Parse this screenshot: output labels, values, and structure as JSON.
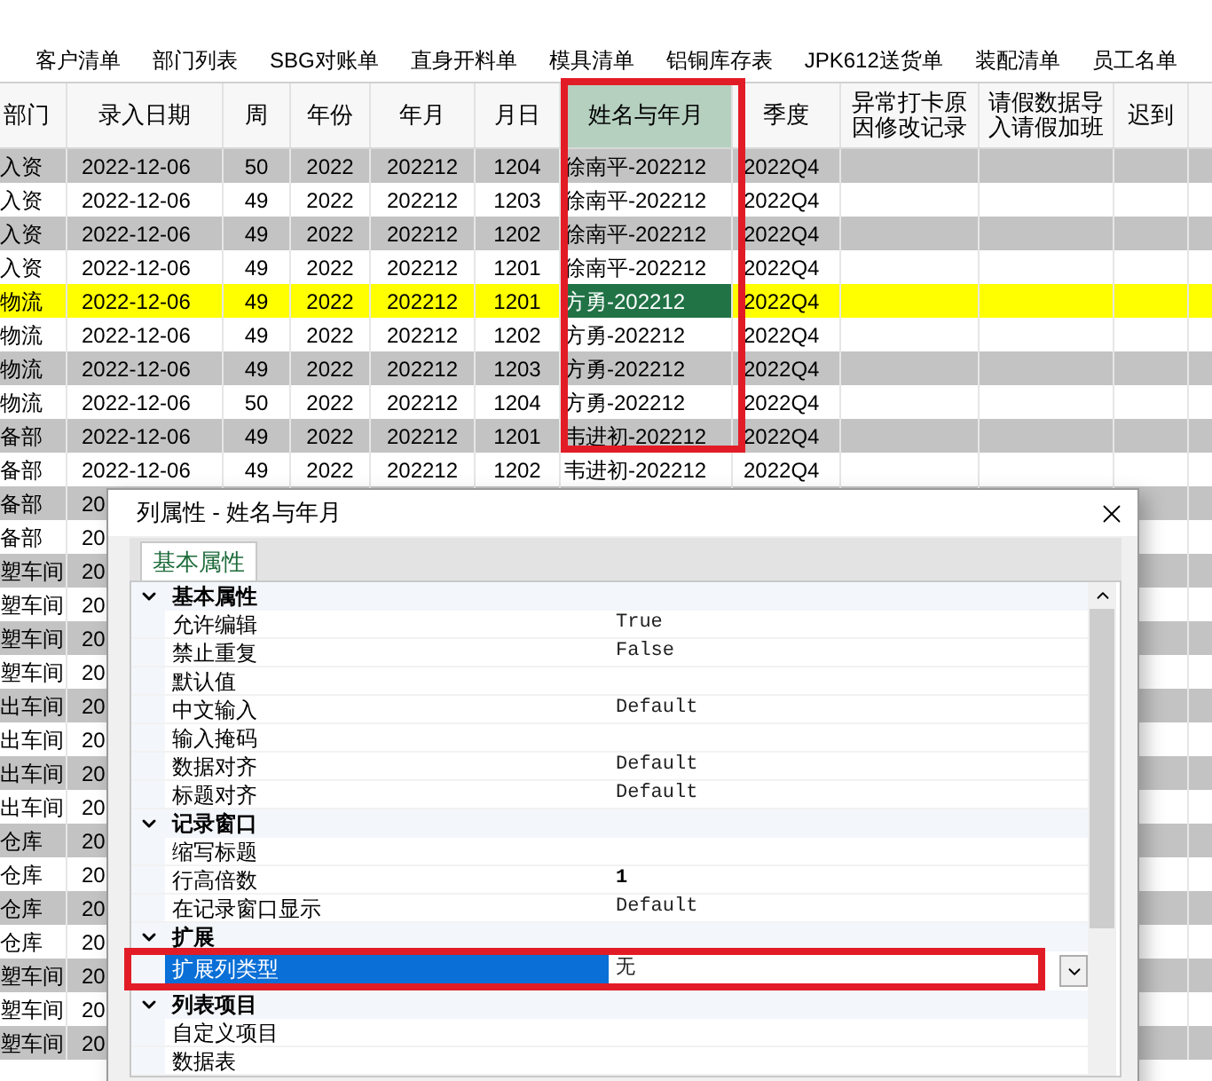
{
  "tabs": [
    {
      "label": "客户清单"
    },
    {
      "label": "部门列表"
    },
    {
      "label": "SBG对账单"
    },
    {
      "label": "直身开料单"
    },
    {
      "label": "模具清单"
    },
    {
      "label": "铝铜库存表"
    },
    {
      "label": "JPK612送货单"
    },
    {
      "label": "装配清单"
    },
    {
      "label": "员工名单"
    }
  ],
  "table": {
    "columns": [
      {
        "label": "部门",
        "selected": false
      },
      {
        "label": "录入日期",
        "selected": false
      },
      {
        "label": "周",
        "selected": false
      },
      {
        "label": "年份",
        "selected": false
      },
      {
        "label": "年月",
        "selected": false
      },
      {
        "label": "月日",
        "selected": false
      },
      {
        "label": "姓名与年月",
        "selected": true
      },
      {
        "label": "季度",
        "selected": false
      },
      {
        "label": "异常打卡原因修改记录",
        "selected": false
      },
      {
        "label": "请假数据导入请假加班",
        "selected": false
      },
      {
        "label": "迟到",
        "selected": false
      }
    ],
    "rows": [
      {
        "selected": false,
        "cells": [
          "入资",
          "2022-12-06",
          "50",
          "2022",
          "202212",
          "1204",
          "徐南平-202212",
          "2022Q4"
        ]
      },
      {
        "selected": false,
        "cells": [
          "入资",
          "2022-12-06",
          "49",
          "2022",
          "202212",
          "1203",
          "徐南平-202212",
          "2022Q4"
        ]
      },
      {
        "selected": false,
        "cells": [
          "入资",
          "2022-12-06",
          "49",
          "2022",
          "202212",
          "1202",
          "徐南平-202212",
          "2022Q4"
        ]
      },
      {
        "selected": false,
        "cells": [
          "入资",
          "2022-12-06",
          "49",
          "2022",
          "202212",
          "1201",
          "徐南平-202212",
          "2022Q4"
        ]
      },
      {
        "selected": true,
        "cells": [
          "物流",
          "2022-12-06",
          "49",
          "2022",
          "202212",
          "1201",
          "方勇-202212",
          "2022Q4"
        ]
      },
      {
        "selected": false,
        "cells": [
          "物流",
          "2022-12-06",
          "49",
          "2022",
          "202212",
          "1202",
          "方勇-202212",
          "2022Q4"
        ]
      },
      {
        "selected": false,
        "cells": [
          "物流",
          "2022-12-06",
          "49",
          "2022",
          "202212",
          "1203",
          "方勇-202212",
          "2022Q4"
        ]
      },
      {
        "selected": false,
        "cells": [
          "物流",
          "2022-12-06",
          "50",
          "2022",
          "202212",
          "1204",
          "方勇-202212",
          "2022Q4"
        ]
      },
      {
        "selected": false,
        "cells": [
          "备部",
          "2022-12-06",
          "49",
          "2022",
          "202212",
          "1201",
          "韦进初-202212",
          "2022Q4"
        ]
      },
      {
        "selected": false,
        "cells": [
          "备部",
          "2022-12-06",
          "49",
          "2022",
          "202212",
          "1202",
          "韦进初-202212",
          "2022Q4"
        ]
      },
      {
        "selected": false,
        "cells": [
          "备部",
          "20"
        ]
      },
      {
        "selected": false,
        "cells": [
          "备部",
          "20"
        ]
      },
      {
        "selected": false,
        "cells": [
          "塑车间",
          "20"
        ]
      },
      {
        "selected": false,
        "cells": [
          "塑车间",
          "20"
        ]
      },
      {
        "selected": false,
        "cells": [
          "塑车间",
          "20"
        ]
      },
      {
        "selected": false,
        "cells": [
          "塑车间",
          "20"
        ]
      },
      {
        "selected": false,
        "cells": [
          "出车间",
          "20"
        ]
      },
      {
        "selected": false,
        "cells": [
          "出车间",
          "20"
        ]
      },
      {
        "selected": false,
        "cells": [
          "出车间",
          "20"
        ]
      },
      {
        "selected": false,
        "cells": [
          "出车间",
          "20"
        ]
      },
      {
        "selected": false,
        "cells": [
          "仓库",
          "20"
        ]
      },
      {
        "selected": false,
        "cells": [
          "仓库",
          "20"
        ]
      },
      {
        "selected": false,
        "cells": [
          "仓库",
          "20"
        ]
      },
      {
        "selected": false,
        "cells": [
          "仓库",
          "20"
        ]
      },
      {
        "selected": false,
        "cells": [
          "塑车间",
          "20"
        ]
      },
      {
        "selected": false,
        "cells": [
          "塑车间",
          "20"
        ]
      },
      {
        "selected": false,
        "cells": [
          "塑车间",
          "20"
        ]
      }
    ]
  },
  "dialog": {
    "title": "列属性 - 姓名与年月",
    "tabs": [
      {
        "label": "基本属性",
        "selected": true
      }
    ],
    "properties": [
      {
        "kind": "category",
        "label": "基本属性",
        "expanded": true
      },
      {
        "kind": "property",
        "name": "允许编辑",
        "value": "True",
        "modified": false,
        "selected": false
      },
      {
        "kind": "property",
        "name": "禁止重复",
        "value": "False",
        "modified": false,
        "selected": false
      },
      {
        "kind": "property",
        "name": "默认值",
        "selected": false
      },
      {
        "kind": "property",
        "name": "中文输入",
        "value": "Default",
        "modified": false,
        "selected": false
      },
      {
        "kind": "property",
        "name": "输入掩码",
        "selected": false
      },
      {
        "kind": "property",
        "name": "数据对齐",
        "value": "Default",
        "modified": false,
        "selected": false
      },
      {
        "kind": "property",
        "name": "标题对齐",
        "value": "Default",
        "modified": false,
        "selected": false
      },
      {
        "kind": "category",
        "label": "记录窗口",
        "expanded": true
      },
      {
        "kind": "property",
        "name": "缩写标题",
        "selected": false
      },
      {
        "kind": "property",
        "name": "行高倍数",
        "value": "1",
        "modified": true,
        "selected": false
      },
      {
        "kind": "property",
        "name": "在记录窗口显示",
        "value": "Default",
        "modified": false,
        "selected": false
      },
      {
        "kind": "category",
        "label": "扩展",
        "expanded": true
      },
      {
        "kind": "property",
        "name": "扩展列类型",
        "value": "无",
        "modified": false,
        "selected": true
      },
      {
        "kind": "category",
        "label": "列表项目",
        "expanded": true
      },
      {
        "kind": "property",
        "name": "自定义项目",
        "selected": false
      },
      {
        "kind": "property",
        "name": "数据表",
        "selected": false
      }
    ]
  }
}
